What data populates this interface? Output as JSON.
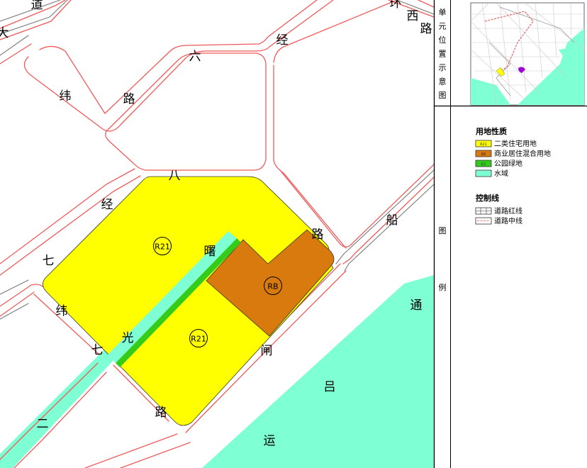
{
  "colors": {
    "residential": "#ffff00",
    "commercial": "#d97a0f",
    "park": "#33cc1a",
    "water": "#7fffd4",
    "road_red": "#ef5a5a",
    "road_gray": "#7a7a7a",
    "text": "#000000",
    "panel_border": "#000000",
    "minimap_highlight": "#a100d6"
  },
  "map_labels": [
    {
      "id": "l-dao",
      "text": "道"
    },
    {
      "id": "l-da",
      "text": "大"
    },
    {
      "id": "l-huan",
      "text": "环"
    },
    {
      "id": "l-xi",
      "text": "西"
    },
    {
      "id": "l-lu1",
      "text": "路"
    },
    {
      "id": "l-jing1",
      "text": "经"
    },
    {
      "id": "l-liu",
      "text": "六"
    },
    {
      "id": "l-wei1",
      "text": "纬"
    },
    {
      "id": "l-lu2",
      "text": "路"
    },
    {
      "id": "l-ba",
      "text": "八"
    },
    {
      "id": "l-jing2",
      "text": "经"
    },
    {
      "id": "l-lu3",
      "text": "路"
    },
    {
      "id": "l-chuan",
      "text": "船"
    },
    {
      "id": "l-shu",
      "text": "曙"
    },
    {
      "id": "l-qi1",
      "text": "七"
    },
    {
      "id": "l-wei2",
      "text": "纬"
    },
    {
      "id": "l-qi2",
      "text": "七"
    },
    {
      "id": "l-guang",
      "text": "光"
    },
    {
      "id": "l-zha",
      "text": "闸"
    },
    {
      "id": "l-tong",
      "text": "通"
    },
    {
      "id": "l-lv",
      "text": "吕"
    },
    {
      "id": "l-yun",
      "text": "运"
    },
    {
      "id": "l-er",
      "text": "二"
    },
    {
      "id": "l-lu4",
      "text": "路"
    }
  ],
  "parcel_codes": [
    {
      "id": "pc-r21-top",
      "text": "R21"
    },
    {
      "id": "pc-rb",
      "text": "RB"
    },
    {
      "id": "pc-r21-bottom",
      "text": "R21"
    }
  ],
  "side_panel": {
    "location_title_chars": [
      "单",
      "元",
      "位",
      "置",
      "示",
      "意",
      "图"
    ],
    "legend_title_chars": [
      "图",
      "例"
    ],
    "land_use_heading": "用地性质",
    "land_use_items": [
      {
        "swatch_key": "residential",
        "code": "R21",
        "label": "二类住宅用地"
      },
      {
        "swatch_key": "commercial",
        "code": "RB",
        "label": "商业居住混合用地"
      },
      {
        "swatch_key": "park",
        "code": "G1",
        "label": "公园绿地"
      },
      {
        "swatch_key": "water",
        "code": "",
        "label": "水域"
      }
    ],
    "control_heading": "控制线",
    "control_items": [
      {
        "kind": "red-line",
        "label": "道路红线"
      },
      {
        "kind": "center-line",
        "label": "道路中线"
      }
    ]
  }
}
